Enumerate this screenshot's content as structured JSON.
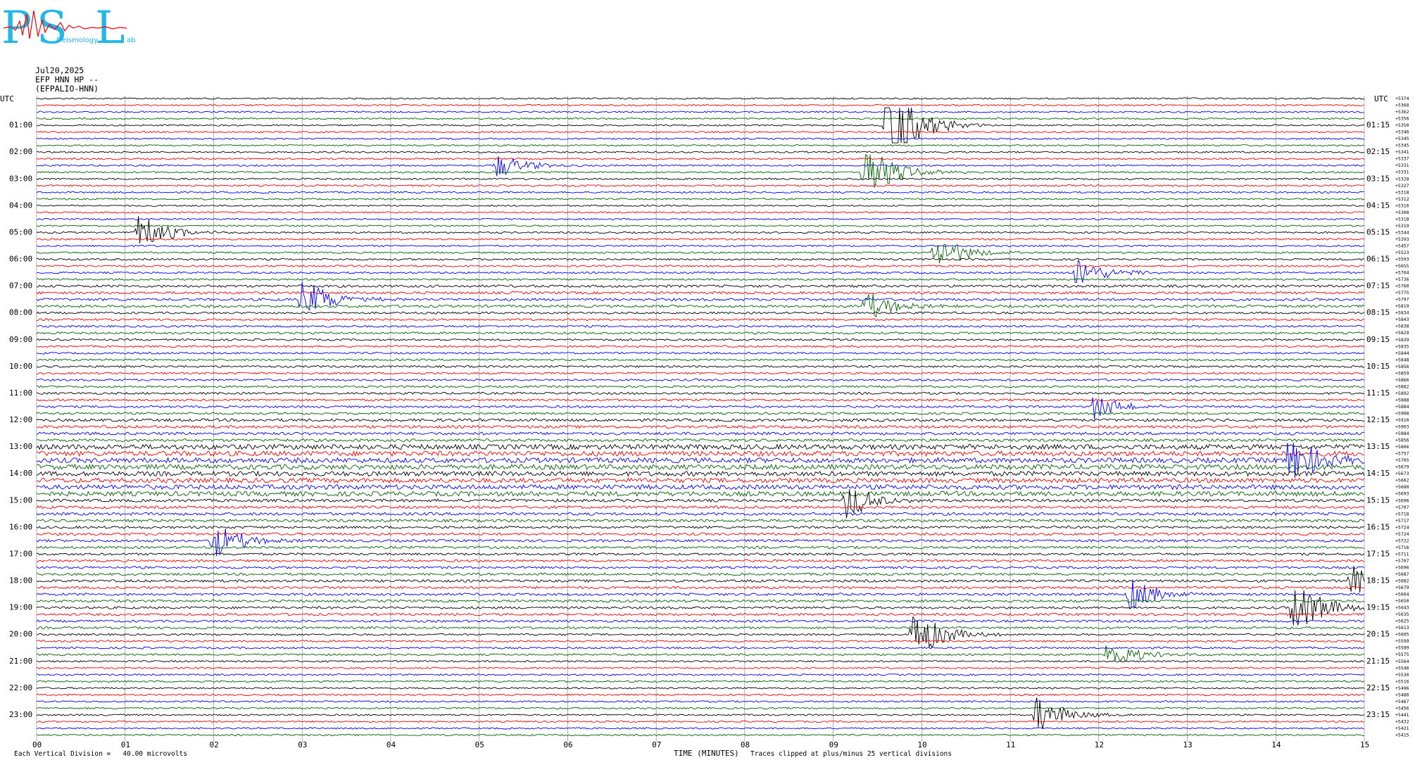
{
  "logo": {
    "letters": [
      "P",
      "S",
      "L"
    ],
    "words": [
      "S",
      "eismology",
      "ab"
    ]
  },
  "header": {
    "date": "Jul20,2025",
    "station": "EFP HNN HP --",
    "channel": "(EFPALIO-HNN)"
  },
  "footer": {
    "scale": "Each Vertical Division =   40.00 microvolts",
    "xlabel": "TIME (MINUTES)",
    "clip": "Traces clipped at plus/minus 25 vertical divisions"
  },
  "colors": {
    "trace_cycle": [
      "#000000",
      "#ff0000",
      "#0000ff",
      "#006400"
    ],
    "grid": "#808080",
    "logo": "#22b7e6"
  },
  "chart_data": {
    "type": "line",
    "title": "",
    "xlabel": "TIME (MINUTES)",
    "ylabel": "",
    "xlim": [
      0,
      15
    ],
    "x_ticks": [
      "00",
      "01",
      "02",
      "03",
      "04",
      "05",
      "06",
      "07",
      "08",
      "09",
      "10",
      "11",
      "12",
      "13",
      "14",
      "15"
    ],
    "left_axis_label": "UTC",
    "right_axis_label": "UTC",
    "left_ticks": [
      "01:00",
      "02:00",
      "03:00",
      "04:00",
      "05:00",
      "06:00",
      "07:00",
      "08:00",
      "09:00",
      "10:00",
      "11:00",
      "12:00",
      "13:00",
      "14:00",
      "15:00",
      "16:00",
      "17:00",
      "18:00",
      "19:00",
      "20:00",
      "21:00",
      "22:00",
      "23:00"
    ],
    "right_ticks": [
      "01:15",
      "02:15",
      "03:15",
      "04:15",
      "05:15",
      "06:15",
      "07:15",
      "08:15",
      "09:15",
      "10:15",
      "11:15",
      "12:15",
      "13:15",
      "14:15",
      "15:15",
      "16:15",
      "17:15",
      "18:15",
      "19:15",
      "20:15",
      "21:15",
      "22:15",
      "23:15"
    ],
    "trace_count": 96,
    "trace_minutes": 15,
    "offsets": [
      "+5374",
      "+5368",
      "+5362",
      "+5356",
      "+5350",
      "+5346",
      "+5345",
      "+5345",
      "+5341",
      "+5337",
      "+5331",
      "+5331",
      "+5328",
      "+5327",
      "+5318",
      "+5312",
      "+5310",
      "+5308",
      "+5318",
      "+5319",
      "+5344",
      "+5393",
      "+5457",
      "+5523",
      "+5593",
      "+5655",
      "+5704",
      "+5736",
      "+5760",
      "+5775",
      "+5797",
      "+5819",
      "+5834",
      "+5843",
      "+5838",
      "+5829",
      "+5839",
      "+5835",
      "+5844",
      "+5848",
      "+5856",
      "+5859",
      "+5866",
      "+5882",
      "+5892",
      "+5888",
      "+5884",
      "+5908",
      "+5910",
      "+5903",
      "+5884",
      "+5856",
      "+5806",
      "+5757",
      "+5705",
      "+5679",
      "+5673",
      "+5662",
      "+5680",
      "+5693",
      "+5696",
      "+5707",
      "+5718",
      "+5717",
      "+5724",
      "+5724",
      "+5722",
      "+5716",
      "+5711",
      "+5707",
      "+5696",
      "+5687",
      "+5682",
      "+5679",
      "+5664",
      "+5650",
      "+5643",
      "+5635",
      "+5625",
      "+5613",
      "+5605",
      "+5599",
      "+5589",
      "+5575",
      "+5564",
      "+5546",
      "+5530",
      "+5516",
      "+5496",
      "+5480",
      "+5467",
      "+5456",
      "+5441",
      "+5432",
      "+5421",
      "+5415"
    ],
    "noise_levels_by_hour": [
      1.0,
      1.0,
      1.1,
      1.1,
      1.0,
      1.1,
      1.2,
      1.6,
      1.3,
      1.2,
      1.3,
      1.4,
      1.8,
      3.2,
      3.0,
      1.8,
      1.6,
      1.5,
      1.6,
      1.5,
      1.2,
      1.1,
      1.1,
      1.0
    ],
    "events": [
      {
        "trace": 4,
        "minute": 9.6,
        "amplitude": 16,
        "color_index": 1
      },
      {
        "trace": 11,
        "minute": 9.35,
        "amplitude": 10,
        "color_index": 0
      },
      {
        "trace": 10,
        "minute": 5.2,
        "amplitude": 4,
        "color_index": 3
      },
      {
        "trace": 20,
        "minute": 1.15,
        "amplitude": 6,
        "color_index": 1
      },
      {
        "trace": 23,
        "minute": 10.15,
        "amplitude": 6,
        "color_index": 0
      },
      {
        "trace": 26,
        "minute": 11.75,
        "amplitude": 5,
        "color_index": 1
      },
      {
        "trace": 30,
        "minute": 3.0,
        "amplitude": 7,
        "color_index": 2
      },
      {
        "trace": 31,
        "minute": 9.35,
        "amplitude": 5,
        "color_index": 0
      },
      {
        "trace": 46,
        "minute": 11.95,
        "amplitude": 4,
        "color_index": 0
      },
      {
        "trace": 54,
        "minute": 14.15,
        "amplitude": 9,
        "color_index": 2
      },
      {
        "trace": 60,
        "minute": 9.15,
        "amplitude": 6,
        "color_index": 0
      },
      {
        "trace": 66,
        "minute": 2.0,
        "amplitude": 6,
        "color_index": 3
      },
      {
        "trace": 74,
        "minute": 12.35,
        "amplitude": 5,
        "color_index": 0
      },
      {
        "trace": 76,
        "minute": 14.2,
        "amplitude": 10,
        "color_index": 2
      },
      {
        "trace": 80,
        "minute": 9.9,
        "amplitude": 9,
        "color_index": 0
      },
      {
        "trace": 83,
        "minute": 12.1,
        "amplitude": 5,
        "color_index": 3
      },
      {
        "trace": 92,
        "minute": 11.3,
        "amplitude": 6,
        "color_index": 0
      },
      {
        "trace": 72,
        "minute": 14.85,
        "amplitude": 5,
        "color_index": 0
      }
    ]
  }
}
